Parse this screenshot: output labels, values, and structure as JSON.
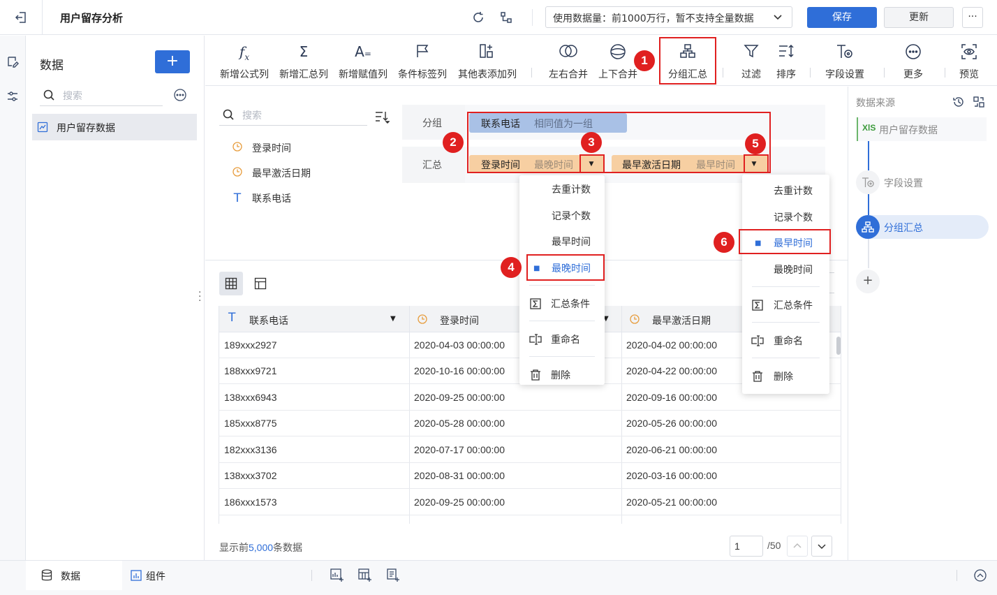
{
  "header": {
    "title": "用户留存分析",
    "data_volume": "使用数据量：前1000万行，暂不支持全量数据",
    "save": "保存",
    "update": "更新",
    "more": "···"
  },
  "sidebar": {
    "title": "数据",
    "add": "+",
    "search_placeholder": "搜索",
    "dataset": "用户留存数据"
  },
  "toolbar": {
    "items": [
      {
        "label": "新增公式列",
        "icon": "formula-icon"
      },
      {
        "label": "新增汇总列",
        "icon": "sigma-icon"
      },
      {
        "label": "新增赋值列",
        "icon": "assign-icon"
      },
      {
        "label": "条件标签列",
        "icon": "flag-icon"
      },
      {
        "label": "其他表添加列",
        "icon": "add-column-icon"
      },
      {
        "label": "左右合并",
        "icon": "merge-lr-icon"
      },
      {
        "label": "上下合并",
        "icon": "merge-ud-icon"
      },
      {
        "label": "分组汇总",
        "icon": "group-summary-icon"
      },
      {
        "label": "过滤",
        "icon": "filter-icon"
      },
      {
        "label": "排序",
        "icon": "sort-icon"
      },
      {
        "label": "字段设置",
        "icon": "field-settings-icon"
      },
      {
        "label": "更多",
        "icon": "more-icon"
      },
      {
        "label": "预览",
        "icon": "preview-icon"
      }
    ]
  },
  "fields": {
    "search_placeholder": "搜索",
    "items": [
      {
        "label": "登录时间",
        "type": "time"
      },
      {
        "label": "最早激活日期",
        "type": "time"
      },
      {
        "label": "联系电话",
        "type": "text"
      }
    ]
  },
  "config": {
    "group_label": "分组",
    "summary_label": "汇总",
    "group_field": {
      "name": "联系电话",
      "mode": "相同值为一组"
    },
    "summary_fields": [
      {
        "name": "登录时间",
        "mode": "最晚时间"
      },
      {
        "name": "最早激活日期",
        "mode": "最早时间"
      }
    ]
  },
  "menus": {
    "left": {
      "options": [
        "去重计数",
        "记录个数",
        "最早时间",
        "最晚时间"
      ],
      "selected": "最晚时间",
      "actions": [
        "汇总条件",
        "重命名",
        "删除"
      ]
    },
    "right": {
      "options": [
        "去重计数",
        "记录个数",
        "最早时间",
        "最晚时间"
      ],
      "selected": "最早时间",
      "actions": [
        "汇总条件",
        "重命名",
        "删除"
      ]
    }
  },
  "badges": [
    "1",
    "2",
    "3",
    "4",
    "5",
    "6"
  ],
  "table": {
    "columns": [
      "联系电话",
      "登录时间",
      "最早激活日期"
    ],
    "rows": [
      [
        "189xxx2927",
        "2020-04-03 00:00:00",
        "2020-04-02 00:00:00"
      ],
      [
        "188xxx9721",
        "2020-10-16 00:00:00",
        "2020-04-22 00:00:00"
      ],
      [
        "138xxx6943",
        "2020-09-25 00:00:00",
        "2020-09-16 00:00:00"
      ],
      [
        "185xxx8775",
        "2020-05-28 00:00:00",
        "2020-05-26 00:00:00"
      ],
      [
        "182xxx3136",
        "2020-07-17 00:00:00",
        "2020-06-21 00:00:00"
      ],
      [
        "138xxx3702",
        "2020-08-31 00:00:00",
        "2020-03-16 00:00:00"
      ],
      [
        "186xxx1573",
        "2020-09-25 00:00:00",
        "2020-05-21 00:00:00"
      ]
    ]
  },
  "footer": {
    "show_prefix": "显示前",
    "show_count": "5,000",
    "show_suffix": "条数据",
    "page": "1",
    "total_pages": "/50"
  },
  "right_panel": {
    "title": "数据来源",
    "steps": [
      {
        "label": "用户留存数据",
        "badge": "XlS",
        "active": false
      },
      {
        "label": "字段设置",
        "active": false
      },
      {
        "label": "分组汇总",
        "active": true
      }
    ],
    "add": "+"
  },
  "bottom": {
    "tab_data": "数据",
    "tab_component": "组件"
  },
  "colors": {
    "primary": "#2f6ed8",
    "red": "#e02020",
    "group_chip": "#a9c1e6",
    "summary_chip": "#f7cfa2",
    "time_icon": "#e79c3c"
  }
}
